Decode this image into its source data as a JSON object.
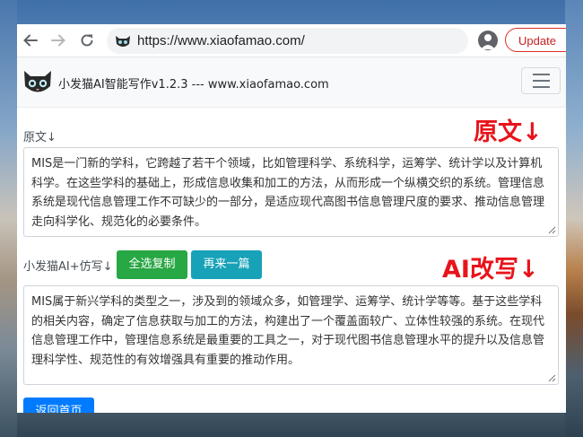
{
  "browser": {
    "url": "https://www.xiaofamao.com/",
    "update_label": "Update"
  },
  "site": {
    "brand": "小发猫AI智能写作v1.2.3 --- www.xiaofamao.com"
  },
  "original": {
    "label": "原文↓",
    "heading": "原文↓",
    "text": "MIS是一门新的学科，它跨越了若干个领域，比如管理科学、系统科学，运筹学、统计学以及计算机科学。在这些学科的基础上，形成信息收集和加工的方法，从而形成一个纵横交织的系统。管理信息系统是现代信息管理工作不可缺少的一部分，是适应现代高图书信息管理尺度的要求、推动信息管理走向科学化、规范化的必要条件。"
  },
  "rewrite": {
    "label": "小发猫AI+仿写↓",
    "heading": "AI改写↓",
    "copy_all_label": "全选复制",
    "again_label": "再来一篇",
    "text": "MIS属于新兴学科的类型之一，涉及到的领域众多，如管理学、运筹学、统计学等等。基于这些学科的相关内容，确定了信息获取与加工的方法，构建出了一个覆盖面较广、立体性较强的系统。在现代信息管理工作中，管理信息系统是最重要的工具之一，对于现代图书信息管理水平的提升以及信息管理科学性、规范性的有效增强具有重要的推动作用。",
    "back_label": "返回首页"
  },
  "icons": {
    "back": "arrow-left-icon",
    "forward": "arrow-right-icon",
    "reload": "reload-icon",
    "favicon": "cat-favicon-icon",
    "profile": "profile-icon",
    "menu": "hamburger-menu-icon",
    "logo": "cat-logo-icon"
  },
  "colors": {
    "accent_red": "#e8141b",
    "green": "#28a745",
    "teal": "#17a2b8",
    "blue": "#007bff"
  }
}
